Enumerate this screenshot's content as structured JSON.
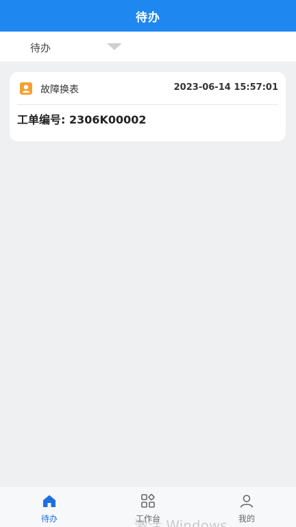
{
  "header": {
    "title": "待办"
  },
  "filter": {
    "label": "待办"
  },
  "tasks": [
    {
      "type_icon": "user-badge-icon",
      "type": "故障换表",
      "time": "2023-06-14 15:57:01",
      "order_no": "工单编号: 2306K00002"
    }
  ],
  "tabbar": {
    "items": [
      {
        "label": "待办",
        "icon": "home-icon",
        "active": true
      },
      {
        "label": "工作台",
        "icon": "grid-icon",
        "active": false
      },
      {
        "label": "我的",
        "icon": "user-icon",
        "active": false
      }
    ]
  },
  "watermark": "激活 Windows",
  "colors": {
    "primary": "#1e87f0",
    "tab_active": "#1e6fe0",
    "icon_orange": "#f5a033",
    "background": "#eff0f2"
  }
}
